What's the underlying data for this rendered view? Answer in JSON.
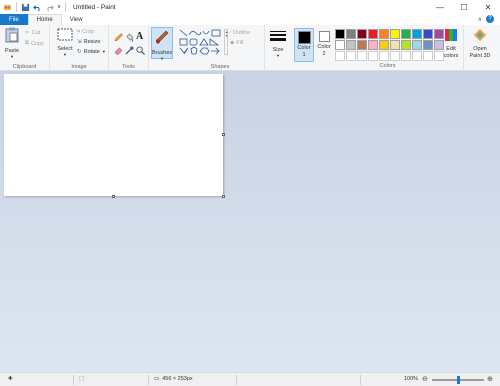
{
  "window": {
    "title": "Untitled - Paint",
    "min": "—",
    "max": "☐",
    "close": "✕"
  },
  "tabs": {
    "file": "File",
    "home": "Home",
    "view": "View",
    "help": "?"
  },
  "ribbon": {
    "clipboard": {
      "group": "Clipboard",
      "paste": "Paste",
      "cut": "Cut",
      "copy": "Copy"
    },
    "image": {
      "group": "Image",
      "select": "Select",
      "crop": "Crop",
      "resize": "Resize",
      "rotate": "Rotate"
    },
    "tools": {
      "group": "Tools"
    },
    "brushes": {
      "label": "Brushes"
    },
    "shapes": {
      "group": "Shapes",
      "outline": "Outline",
      "fill": "Fill"
    },
    "size": {
      "label": "Size"
    },
    "colors": {
      "group": "Colors",
      "color1": "Color\n1",
      "color2": "Color\n2",
      "edit": "Edit\ncolors",
      "paint3d": "Open\nPaint 3D",
      "primary": "#000000",
      "secondary": "#ffffff",
      "row1": [
        "#000000",
        "#7f7f7f",
        "#880015",
        "#ed1c24",
        "#ff7f27",
        "#fff200",
        "#22b14c",
        "#00a2e8",
        "#3f48cc",
        "#a349a4"
      ],
      "row2": [
        "#ffffff",
        "#c3c3c3",
        "#b97a57",
        "#ffaec9",
        "#ffc90e",
        "#efe4b0",
        "#b5e61d",
        "#99d9ea",
        "#7092be",
        "#c8bfe7"
      ]
    }
  },
  "status": {
    "dimensions": "456 × 253px",
    "zoom": "100%",
    "zoom_level": 0.5
  }
}
